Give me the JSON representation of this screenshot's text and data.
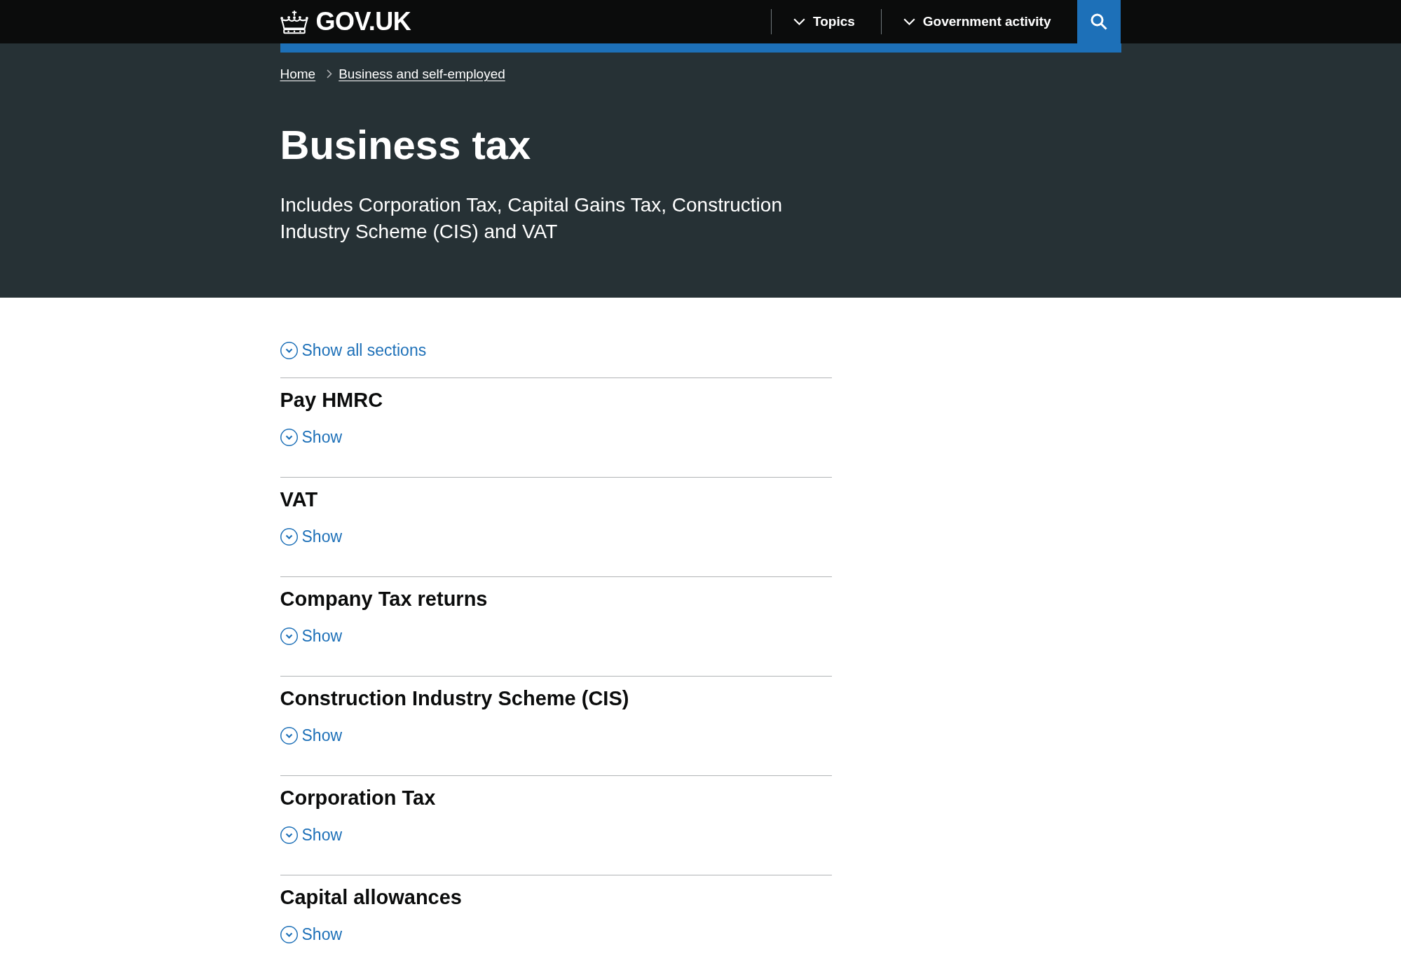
{
  "header": {
    "logo": "GOV.UK",
    "nav": [
      {
        "label": "Topics",
        "expanded": false
      },
      {
        "label": "Government activity",
        "expanded": false
      }
    ]
  },
  "breadcrumbs": [
    {
      "label": "Home"
    },
    {
      "label": "Business and self-employed"
    }
  ],
  "banner": {
    "title": "Business tax",
    "description": "Includes Corporation Tax, Capital Gains Tax, Construction Industry Scheme (CIS) and VAT"
  },
  "accordion": {
    "toggle_all": "Show all sections",
    "sections": [
      {
        "heading": "Pay HMRC",
        "toggle": "Show",
        "expanded": false
      },
      {
        "heading": "VAT",
        "toggle": "Show",
        "expanded": false
      },
      {
        "heading": "Company Tax returns",
        "toggle": "Show",
        "expanded": false
      },
      {
        "heading": "Construction Industry Scheme (CIS)",
        "toggle": "Show",
        "expanded": false
      },
      {
        "heading": "Corporation Tax",
        "toggle": "Show",
        "expanded": false
      },
      {
        "heading": "Capital allowances",
        "toggle": "Show",
        "expanded": false
      }
    ]
  }
}
